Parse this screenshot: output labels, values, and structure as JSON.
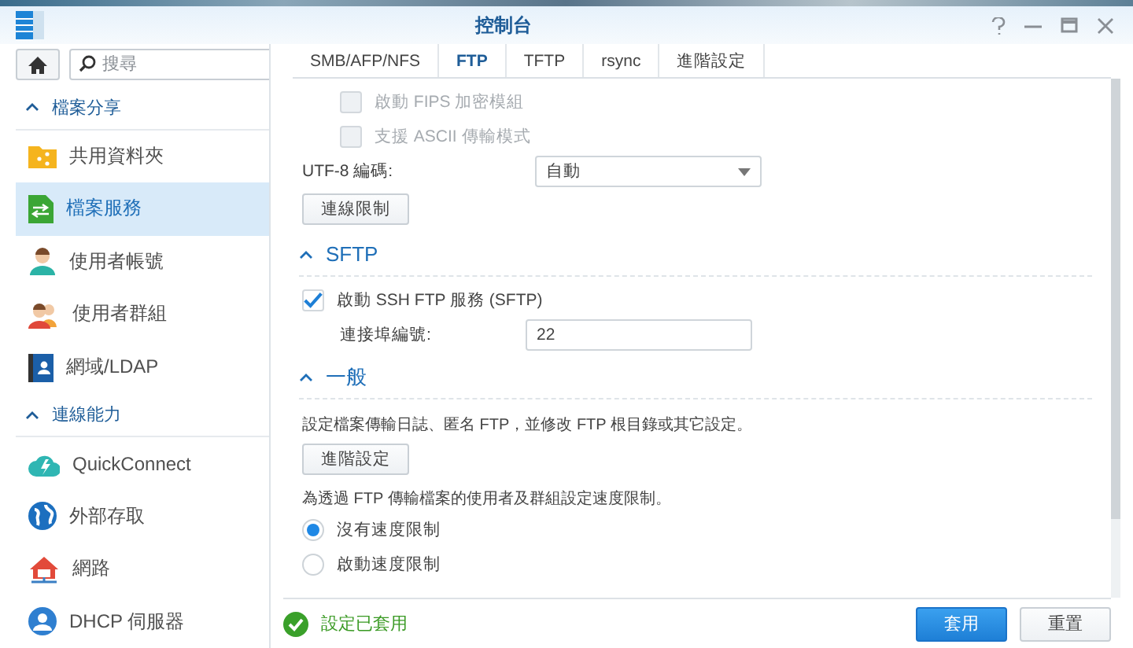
{
  "window": {
    "title": "控制台"
  },
  "sidebar": {
    "search": {
      "placeholder": "搜尋"
    },
    "sections": [
      {
        "title": "檔案分享",
        "expanded": true,
        "items": [
          {
            "label": "共用資料夾",
            "selected": false
          },
          {
            "label": "檔案服務",
            "selected": true
          },
          {
            "label": "使用者帳號",
            "selected": false
          },
          {
            "label": "使用者群組",
            "selected": false
          },
          {
            "label": "網域/LDAP",
            "selected": false
          }
        ]
      },
      {
        "title": "連線能力",
        "expanded": true,
        "items": [
          {
            "label": "QuickConnect",
            "selected": false
          },
          {
            "label": "外部存取",
            "selected": false
          },
          {
            "label": "網路",
            "selected": false
          },
          {
            "label": "DHCP 伺服器",
            "selected": false
          }
        ]
      }
    ]
  },
  "tabs": [
    {
      "label": "SMB/AFP/NFS",
      "selected": false
    },
    {
      "label": "FTP",
      "selected": true
    },
    {
      "label": "TFTP",
      "selected": false
    },
    {
      "label": "rsync",
      "selected": false
    },
    {
      "label": "進階設定",
      "selected": false
    }
  ],
  "sections": [
    {
      "items": [
        {
          "kind": "checkbox",
          "label": "啟動 FIPS 加密模組",
          "checked": false,
          "disabled": true
        },
        {
          "kind": "checkbox",
          "label": "支援 ASCII 傳輸模式",
          "checked": false,
          "disabled": true
        },
        {
          "kind": "select",
          "label": "UTF-8 編碼:",
          "value": "自動"
        },
        {
          "kind": "button",
          "label": "連線限制"
        }
      ]
    },
    {
      "title": "SFTP",
      "expanded": true,
      "items": [
        {
          "kind": "checkbox",
          "label": "啟動 SSH FTP 服務 (SFTP)",
          "checked": true,
          "disabled": false
        },
        {
          "kind": "field",
          "label": "連接埠編號:",
          "value": "22"
        }
      ]
    },
    {
      "title": "一般",
      "expanded": true,
      "items": [
        {
          "kind": "text",
          "label": "設定檔案傳輸日誌、匿名 FTP，並修改 FTP 根目錄或其它設定。"
        },
        {
          "kind": "button",
          "label": "進階設定"
        },
        {
          "kind": "text",
          "label": "為透過 FTP 傳輸檔案的使用者及群組設定速度限制。"
        },
        {
          "kind": "radio",
          "label": "沒有速度限制",
          "selected": true
        },
        {
          "kind": "radio",
          "label": "啟動速度限制",
          "selected": false
        }
      ]
    }
  ],
  "footer": {
    "status": "設定已套用",
    "buttons": [
      {
        "label": "套用",
        "kind": "primary"
      },
      {
        "label": "重置",
        "kind": "default"
      }
    ]
  }
}
